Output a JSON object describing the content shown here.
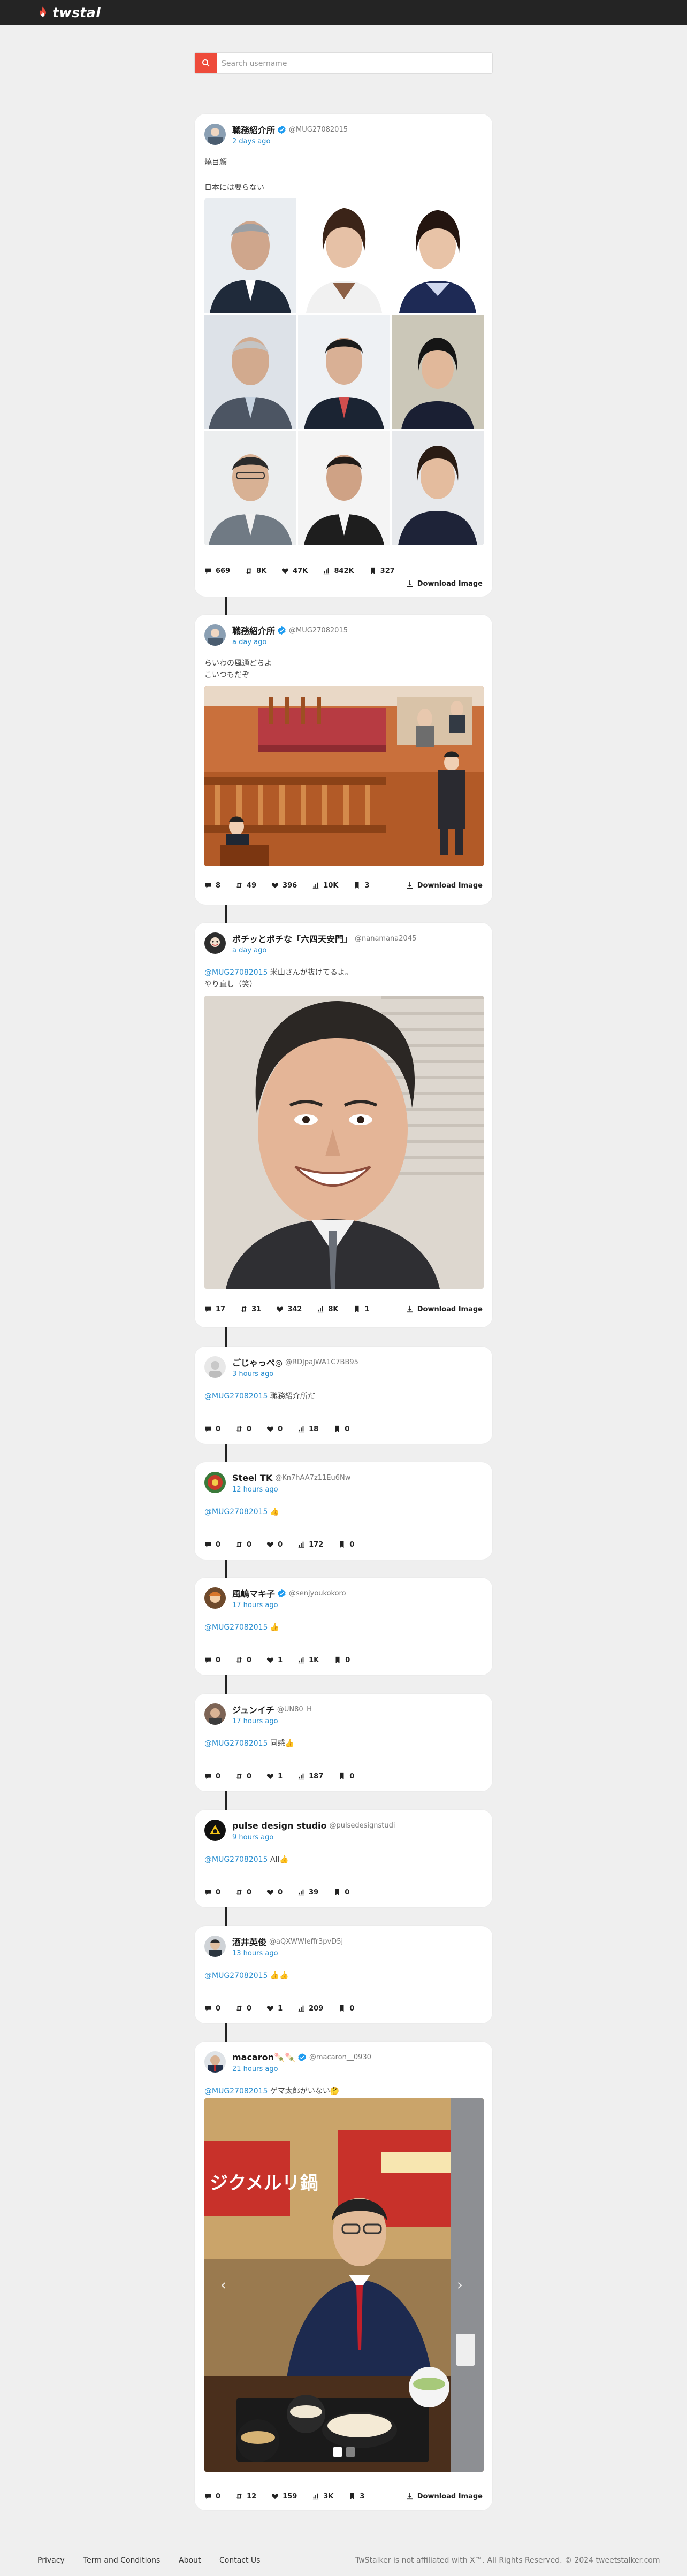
{
  "brand": {
    "name": "twstal"
  },
  "search": {
    "placeholder": "Search username"
  },
  "colors": {
    "accent": "#ee4b3b",
    "link": "#2b8fd0",
    "verified": "#1d9bf0",
    "topbar": "#242424"
  },
  "posts": [
    {
      "name": "職務紹介所",
      "verified": true,
      "handle": "@MUG27082015",
      "time": "2 days ago",
      "text_lines": [
        "燒目顔",
        "",
        "日本には要らない"
      ],
      "media": "photo-grid-3x3-politician-portraits",
      "stats": {
        "replies": "669",
        "retweets": "8K",
        "likes": "47K",
        "views": "842K",
        "bookmarks": "327"
      },
      "download_label": "Download Image"
    },
    {
      "name": "職務紹介所",
      "verified": true,
      "handle": "@MUG27082015",
      "time": "a day ago",
      "text_lines": [
        "らいわの風通どちよ",
        "こいつもだぞ"
      ],
      "media": "illustration-parliament-chamber",
      "stats": {
        "replies": "8",
        "retweets": "49",
        "likes": "396",
        "views": "10K",
        "bookmarks": "3"
      },
      "download_label": "Download Image"
    },
    {
      "name": "ポチッとポチな「六四天安門」",
      "verified": false,
      "handle": "@nanamana2045",
      "time": "a day ago",
      "mention": "@MUG27082015",
      "text_after": " 米山さんが抜けてるよ。",
      "text_line2": "やり直し（笑）",
      "media": "photo-smiling-man-portrait",
      "stats": {
        "replies": "17",
        "retweets": "31",
        "likes": "342",
        "views": "8K",
        "bookmarks": "1"
      },
      "download_label": "Download Image"
    },
    {
      "name": "ごじゃっぺ◎",
      "verified": false,
      "handle": "@RDJpaJWA1C7BB95",
      "time": "3 hours ago",
      "mention": "@MUG27082015",
      "text_after": " 職務紹介所だ",
      "stats": {
        "replies": "0",
        "retweets": "0",
        "likes": "0",
        "views": "18",
        "bookmarks": "0"
      }
    },
    {
      "name": "Steel TK",
      "verified": false,
      "handle": "@Kn7hAA7z11Eu6Nw",
      "time": "12 hours ago",
      "mention": "@MUG27082015",
      "text_after": " 👍",
      "stats": {
        "replies": "0",
        "retweets": "0",
        "likes": "0",
        "views": "172",
        "bookmarks": "0"
      }
    },
    {
      "name": "風嶋マキ子",
      "verified": true,
      "handle": "@senjyoukokoro",
      "time": "17 hours ago",
      "mention": "@MUG27082015",
      "text_after": " 👍",
      "stats": {
        "replies": "0",
        "retweets": "0",
        "likes": "1",
        "views": "1K",
        "bookmarks": "0"
      }
    },
    {
      "name": "ジュンイチ",
      "verified": false,
      "handle": "@UN80_H",
      "time": "17 hours ago",
      "mention": "@MUG27082015",
      "text_after": " 同感👍",
      "stats": {
        "replies": "0",
        "retweets": "0",
        "likes": "1",
        "views": "187",
        "bookmarks": "0"
      }
    },
    {
      "name": "pulse design studio",
      "verified": false,
      "handle": "@pulsedesignstudi",
      "time": "9 hours ago",
      "mention": "@MUG27082015",
      "text_after": " All👍",
      "stats": {
        "replies": "0",
        "retweets": "0",
        "likes": "0",
        "views": "39",
        "bookmarks": "0"
      }
    },
    {
      "name": "酒井英俊",
      "verified": false,
      "handle": "@aQXWWIeffr3pvD5j",
      "time": "13 hours ago",
      "mention": "@MUG27082015",
      "text_after": " 👍👍",
      "stats": {
        "replies": "0",
        "retweets": "0",
        "likes": "1",
        "views": "209",
        "bookmarks": "0"
      }
    },
    {
      "name": "macaron🍡🍡",
      "verified": true,
      "handle": "@macaron__0930",
      "time": "21 hours ago",
      "mention": "@MUG27082015",
      "text_after": " ゲマ太郎がいない🤔",
      "media": "photo-man-eating-at-restaurant-carousel",
      "stats": {
        "replies": "0",
        "retweets": "12",
        "likes": "159",
        "views": "3K",
        "bookmarks": "3"
      },
      "download_label": "Download Image"
    }
  ],
  "restaurant_banner": "ジクメルリ鍋",
  "footer": {
    "links": [
      "Privacy",
      "Term and Conditions",
      "About",
      "Contact Us"
    ],
    "note": "TwStalker is not affiliated with X™. All Rights Reserved. © 2024 tweetstalker.com"
  }
}
